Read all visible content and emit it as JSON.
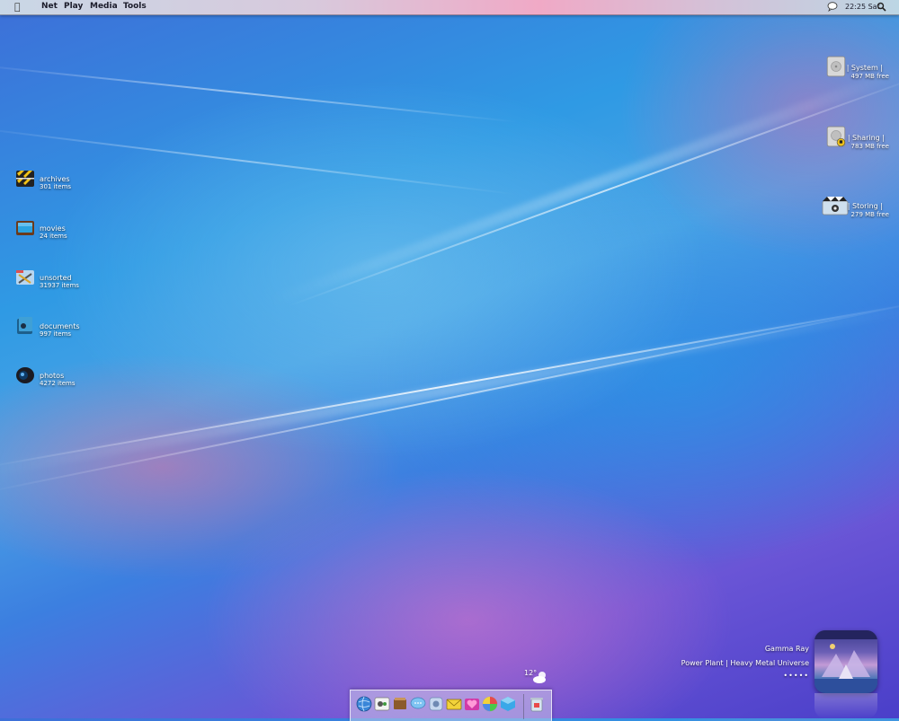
{
  "menubar": {
    "apple_icon": "apple-icon",
    "items": [
      "Net",
      "Play",
      "Media",
      "Tools"
    ],
    "clock": "22:25 Sat",
    "chat_icon": "chat-bubble-icon",
    "search_icon": "search-icon"
  },
  "left_icons": [
    {
      "name": "archives",
      "count": "301  items",
      "icon": "archive-box-icon"
    },
    {
      "name": "movies",
      "count": "24 items",
      "icon": "tv-icon"
    },
    {
      "name": "unsorted",
      "count": "31937  items",
      "icon": "tools-folder-icon"
    },
    {
      "name": "documents",
      "count": "997 items",
      "icon": "documents-icon"
    },
    {
      "name": "photos",
      "count": "4272  items",
      "icon": "camera-lens-icon"
    }
  ],
  "right_icons": [
    {
      "name": "| System |",
      "free": "497 MB free",
      "icon": "hard-drive-icon"
    },
    {
      "name": "| Sharing |",
      "free": "783 MB free",
      "icon": "shared-drive-icon"
    },
    {
      "name": "| Storing |",
      "free": "279 MB free",
      "icon": "storage-drive-icon"
    }
  ],
  "music": {
    "artist": "Gamma Ray",
    "album_line": "Power Plant | Heavy Metal Universe",
    "rating": "•••••"
  },
  "weather": {
    "temperature": "12°",
    "icon": "partly-cloudy-icon"
  },
  "dock": {
    "items": [
      {
        "icon": "globe-icon",
        "color": "#3a86d8"
      },
      {
        "icon": "finder-icon",
        "color": "#f2f2f2"
      },
      {
        "icon": "books-icon",
        "color": "#8b5a2b"
      },
      {
        "icon": "chat-icon",
        "color": "#7ec3f2"
      },
      {
        "icon": "network-icon",
        "color": "#c7d7ef"
      },
      {
        "icon": "mail-icon",
        "color": "#f2d23a"
      },
      {
        "icon": "heart-folder-icon",
        "color": "#d23aa8"
      },
      {
        "icon": "color-picker-icon",
        "color": "#e8e8e8"
      },
      {
        "icon": "cube-icon",
        "color": "#3aa8e8"
      },
      {
        "icon": "trash-icon",
        "color": "#d8e4ee"
      }
    ]
  }
}
